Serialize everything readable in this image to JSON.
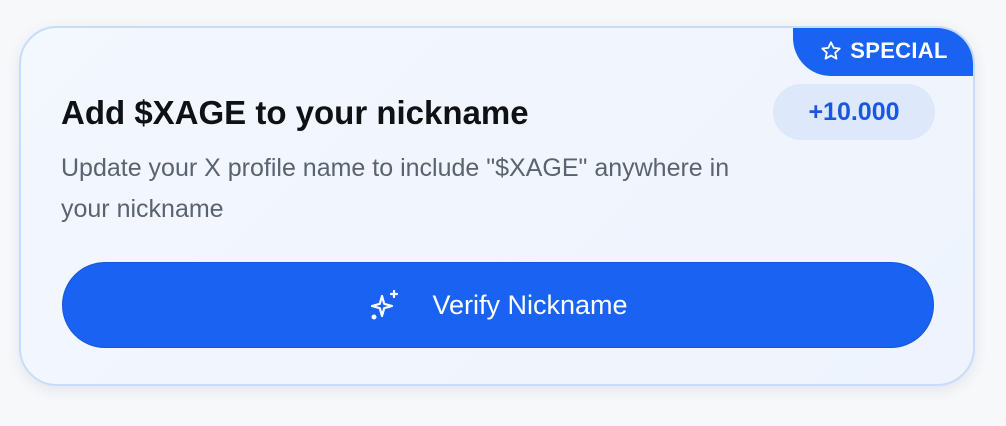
{
  "task_card": {
    "badge_label": "SPECIAL",
    "badge_icon": "star-icon",
    "title": "Add $XAGE to your nickname",
    "points": "+10.000",
    "description": "Update your X profile name to include \"$XAGE\" anywhere in your nickname",
    "verify_button_label": "Verify Nickname",
    "verify_button_icon": "sparkles-icon",
    "accent_color": "#1a62f2",
    "points_text_color": "#1a56e0"
  }
}
